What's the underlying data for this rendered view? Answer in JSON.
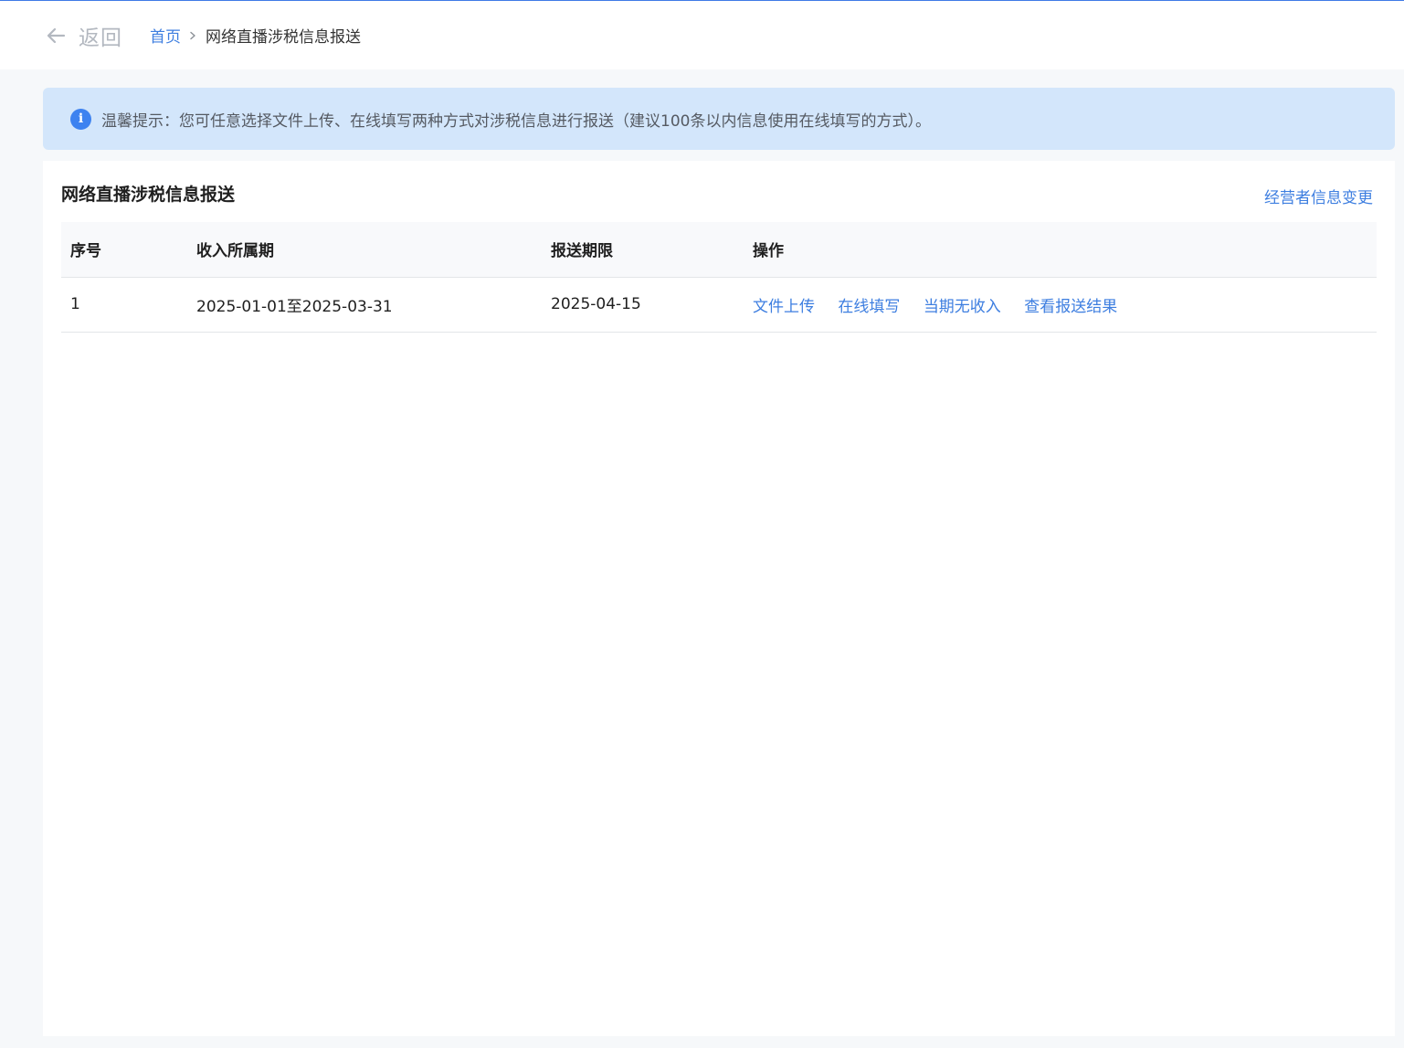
{
  "header": {
    "back_label": "返回",
    "breadcrumb": {
      "home": "首页",
      "current": "网络直播涉税信息报送"
    }
  },
  "notice": {
    "text": "温馨提示：您可任意选择文件上传、在线填写两种方式对涉税信息进行报送（建议100条以内信息使用在线填写的方式）。"
  },
  "panel": {
    "title": "网络直播涉税信息报送",
    "action_link": "经营者信息变更"
  },
  "table": {
    "columns": [
      "序号",
      "收入所属期",
      "报送期限",
      "操作"
    ],
    "rows": [
      {
        "seq": "1",
        "period": "2025-01-01至2025-03-31",
        "deadline": "2025-04-15",
        "actions": [
          "文件上传",
          "在线填写",
          "当期无收入",
          "查看报送结果"
        ]
      }
    ]
  },
  "colors": {
    "accent": "#3d7ee0",
    "notice_bg": "#d3e6fb",
    "info_icon": "#3d82f0"
  }
}
